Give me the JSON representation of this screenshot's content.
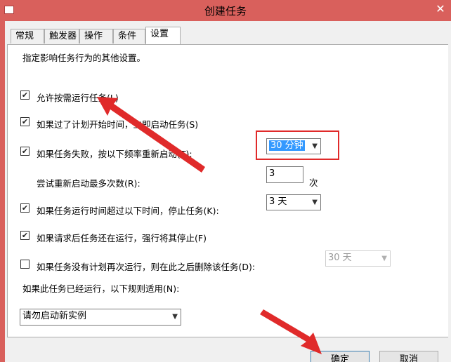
{
  "window": {
    "title": "创建任务"
  },
  "tabs": [
    "常规",
    "触发器",
    "操作",
    "条件",
    "设置"
  ],
  "settings": {
    "description": "指定影响任务行为的其他设置。",
    "allow_on_demand": {
      "label": "允许按需运行任务(L)",
      "checked": true
    },
    "run_asap": {
      "label": "如果过了计划开始时间，立即启动任务(S)",
      "checked": true
    },
    "restart_on_fail": {
      "label": "如果任务失败，按以下频率重新启动(T):",
      "checked": true,
      "value": "30 分钟"
    },
    "retry": {
      "label": "尝试重新启动最多次数(R):",
      "value": "3",
      "unit": "次"
    },
    "stop_if_long": {
      "label": "如果任务运行时间超过以下时间，停止任务(K):",
      "checked": true,
      "value": "3 天"
    },
    "force_stop": {
      "label": "如果请求后任务还在运行，强行将其停止(F)",
      "checked": true
    },
    "delete_if_none": {
      "label": "如果任务没有计划再次运行，则在此之后删除该任务(D):",
      "checked": false,
      "value": "30 天"
    },
    "rule_label": "如果此任务已经运行，以下规则适用(N):",
    "rule_value": "请勿启动新实例"
  },
  "buttons": {
    "ok": "确定",
    "cancel": "取消"
  },
  "checkmark": "✔",
  "colors": {
    "titlebar": "#d9605c",
    "highlight": "#e02a2a",
    "selection": "#3399ff"
  }
}
